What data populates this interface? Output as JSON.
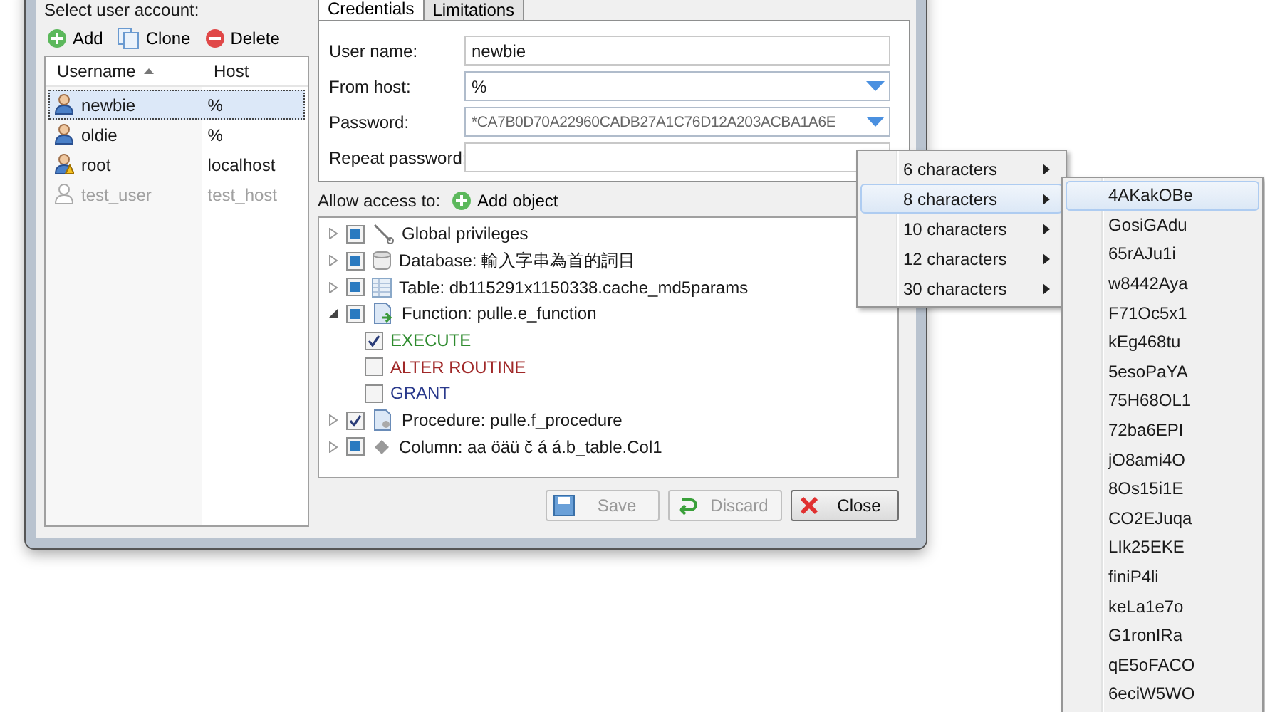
{
  "left_panel": {
    "heading": "Select user account:",
    "toolbar": [
      {
        "kind": "add",
        "label": "Add"
      },
      {
        "kind": "clone",
        "label": "Clone"
      },
      {
        "kind": "delete",
        "label": "Delete"
      }
    ],
    "columns": [
      {
        "label": "Username",
        "sorted": true
      },
      {
        "label": "Host",
        "sorted": false
      }
    ],
    "users": [
      {
        "username": "newbie",
        "host": "%",
        "kind": "user",
        "selected": true,
        "disabled": false
      },
      {
        "username": "oldie",
        "host": "%",
        "kind": "user",
        "selected": false,
        "disabled": false
      },
      {
        "username": "root",
        "host": "localhost",
        "kind": "admin",
        "selected": false,
        "disabled": false
      },
      {
        "username": "test_user",
        "host": "test_host",
        "kind": "user",
        "selected": false,
        "disabled": true
      }
    ]
  },
  "tabs": [
    {
      "label": "Credentials",
      "selected": true
    },
    {
      "label": "Limitations",
      "selected": false
    }
  ],
  "fields": [
    {
      "label": "User name:",
      "value": "newbie",
      "dropdown": false
    },
    {
      "label": "From host:",
      "value": "%",
      "dropdown": true
    },
    {
      "label": "Password:",
      "value": "*CA7B0D70A22960CADB27A1C76D12A203ACBA1A6E",
      "dropdown": true
    },
    {
      "label": "Repeat password:",
      "dropdown": false
    }
  ],
  "access": {
    "label": "Allow access to:",
    "add_button": "Add object"
  },
  "tree": [
    {
      "kind": "global",
      "label": "Global privileges",
      "checked": false,
      "partial": true,
      "expanded": false
    },
    {
      "kind": "database",
      "label": "Database: 輸入字串為首的詞目",
      "checked": false,
      "partial": true,
      "expanded": false
    },
    {
      "kind": "table",
      "label": "Table: db115291x1150338.cache_md5params",
      "checked": false,
      "partial": true,
      "expanded": false
    },
    {
      "kind": "function",
      "label": "Function: pulle.e_function",
      "checked": false,
      "partial": true,
      "expanded": true,
      "children": [
        {
          "label": "EXECUTE",
          "checked": true,
          "color": "#2e8b2e"
        },
        {
          "label": "ALTER ROUTINE",
          "checked": false,
          "color": "#a02828"
        },
        {
          "label": "GRANT",
          "checked": false,
          "color": "#2a3a8c"
        }
      ]
    },
    {
      "kind": "procedure",
      "label": "Procedure: pulle.f_procedure",
      "checked": true,
      "partial": false,
      "expanded": false
    },
    {
      "kind": "column",
      "label": "Column: aa öäü č á á.b_table.Col1",
      "checked": false,
      "partial": true,
      "expanded": false
    }
  ],
  "buttons": [
    {
      "kind": "save",
      "label": "Save",
      "disabled": true
    },
    {
      "kind": "discard",
      "label": "Discard",
      "disabled": true
    },
    {
      "kind": "close",
      "label": "Close",
      "disabled": false
    }
  ],
  "menu": [
    {
      "label": "6 characters",
      "selected": false
    },
    {
      "label": "8 characters",
      "selected": true
    },
    {
      "label": "10 characters",
      "selected": false
    },
    {
      "label": "12 characters",
      "selected": false
    },
    {
      "label": "30 characters",
      "selected": false
    }
  ],
  "submenu": [
    {
      "label": "4AKakOBe",
      "selected": true
    },
    {
      "label": "GosiGAdu",
      "selected": false
    },
    {
      "label": "65rAJu1i",
      "selected": false
    },
    {
      "label": "w8442Aya",
      "selected": false
    },
    {
      "label": "F71Oc5x1",
      "selected": false
    },
    {
      "label": "kEg468tu",
      "selected": false
    },
    {
      "label": "5esoPaYA",
      "selected": false
    },
    {
      "label": "75H68OL1",
      "selected": false
    },
    {
      "label": "72ba6EPI",
      "selected": false
    },
    {
      "label": "jO8ami4O",
      "selected": false
    },
    {
      "label": "8Os15i1E",
      "selected": false
    },
    {
      "label": "CO2EJuqa",
      "selected": false
    },
    {
      "label": "LIk25EKE",
      "selected": false
    },
    {
      "label": "finiP4li",
      "selected": false
    },
    {
      "label": "keLa1e7o",
      "selected": false
    },
    {
      "label": "G1ronIRa",
      "selected": false
    },
    {
      "label": "qE5oFACO",
      "selected": false
    },
    {
      "label": "6eciW5WO",
      "selected": false
    }
  ]
}
